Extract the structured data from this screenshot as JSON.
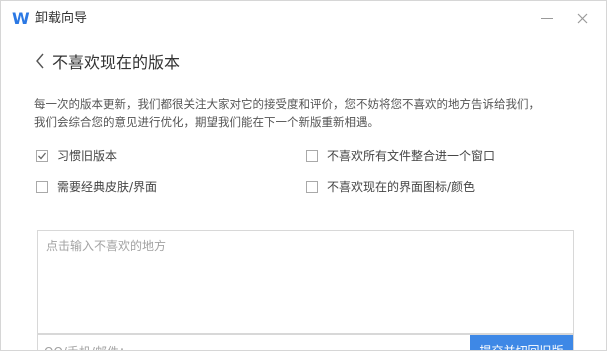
{
  "window": {
    "title": "卸载向导",
    "logo_letter": "W"
  },
  "page": {
    "back_icon": "chevron-left-icon",
    "title": "不喜欢现在的版本",
    "description_line1": "每一次的版本更新，我们都很关注大家对它的接受度和评价，您不妨将您不喜欢的地方告诉给我们，",
    "description_line2": "我们会综合您的意见进行优化，期望我们能在下一个新版重新相遇。"
  },
  "options": [
    {
      "label": "习惯旧版本",
      "checked": true
    },
    {
      "label": "不喜欢所有文件整合进一个窗口",
      "checked": false
    },
    {
      "label": "需要经典皮肤/界面",
      "checked": false
    },
    {
      "label": "不喜欢现在的界面图标/颜色",
      "checked": false
    }
  ],
  "feedback": {
    "placeholder": "点击输入不喜欢的地方",
    "contact_placeholder": "QQ/手机/邮件：",
    "submit_label": "提交并切回旧版"
  },
  "colors": {
    "accent": "#3e88e6",
    "logo": "#2b78e4"
  }
}
